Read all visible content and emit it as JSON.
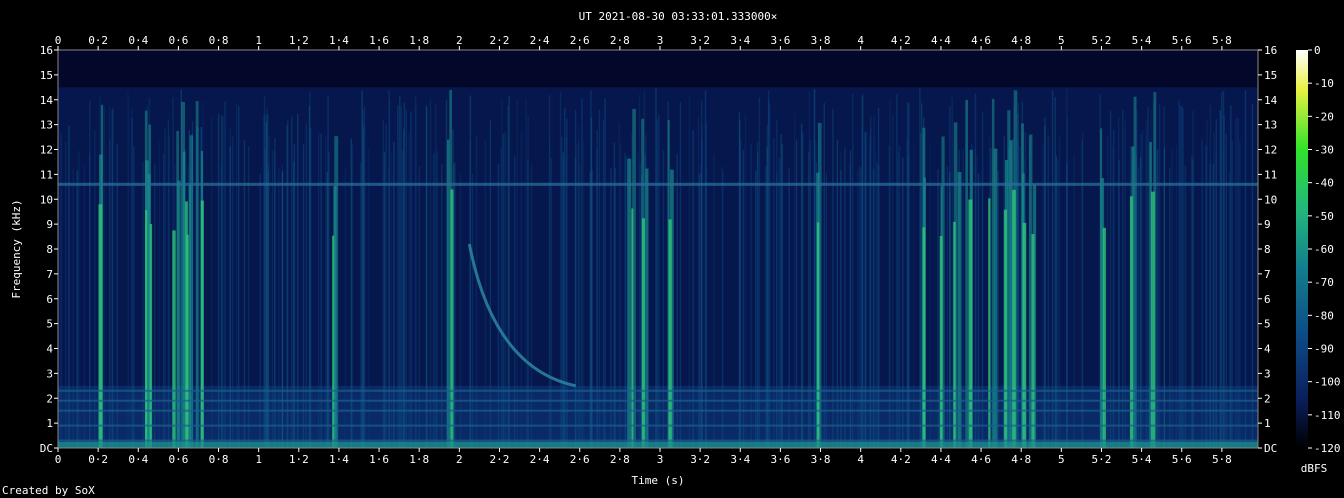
{
  "chart_data": {
    "type": "heatmap",
    "title": "UT 2021-08-30 03:33:01.333000×",
    "xlabel": "Time (s)",
    "ylabel": "Frequency (kHz)",
    "xlim": [
      0,
      5.98
    ],
    "ylim": [
      0,
      16
    ],
    "x_ticks": [
      "0",
      "0·2",
      "0·4",
      "0·6",
      "0·8",
      "1",
      "1·2",
      "1·4",
      "1·6",
      "1·8",
      "2",
      "2·2",
      "2·4",
      "2·6",
      "2·8",
      "3",
      "3·2",
      "3·4",
      "3·6",
      "3·8",
      "4",
      "4·2",
      "4·4",
      "4·6",
      "4·8",
      "5",
      "5·2",
      "5·4",
      "5·6",
      "5·8"
    ],
    "y_ticks": [
      "DC",
      "1",
      "2",
      "3",
      "4",
      "5",
      "6",
      "7",
      "8",
      "9",
      "10",
      "11",
      "12",
      "13",
      "14",
      "15",
      "16"
    ],
    "colorbar": {
      "label": "dBFS",
      "range": [
        -120,
        0
      ],
      "ticks": [
        "0",
        "-10",
        "-20",
        "-30",
        "-40",
        "-50",
        "-60",
        "-70",
        "-80",
        "-90",
        "-100",
        "-110",
        "-120"
      ],
      "colors": [
        "#000000",
        "#0a1e5a",
        "#0c4a86",
        "#127d8e",
        "#22b77a",
        "#30e22a",
        "#e8f040",
        "#ffffff"
      ]
    },
    "features": {
      "horizontal_line_khz": 10.6,
      "low_band_khz": [
        0.2,
        2.5
      ],
      "whistler": {
        "start": [
          2.05,
          8.2
        ],
        "end": [
          2.58,
          2.5
        ]
      },
      "strong_bursts_s": [
        0.2,
        0.42,
        0.45,
        0.58,
        0.62,
        0.65,
        0.7,
        1.37,
        1.95,
        2.85,
        2.92,
        3.05,
        3.78,
        4.32,
        4.4,
        4.47,
        4.53,
        4.65,
        4.72,
        4.75,
        4.8,
        4.85,
        5.2,
        5.35,
        5.45
      ]
    }
  },
  "footer": {
    "credit": "Created by SoX"
  }
}
